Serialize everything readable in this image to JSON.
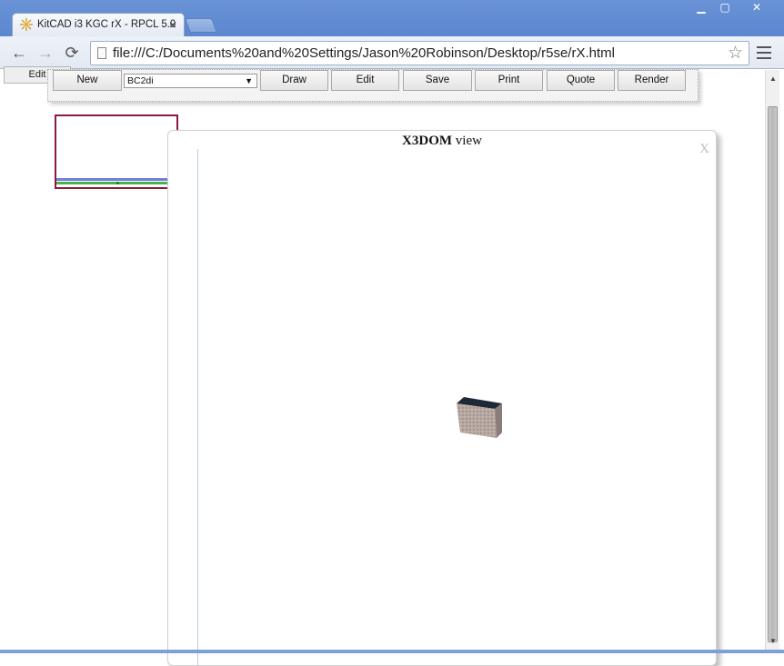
{
  "browser": {
    "tab_title": "KitCAD i3 KGC rX - RPCL 5.0",
    "tab_close": "×",
    "url": "file:///C:/Documents%20and%20Settings/Jason%20Robinson/Desktop/r5se/rX.html",
    "window_controls": {
      "minimize": "▁",
      "maximize": "▢",
      "close": "✕"
    },
    "nav_icons": {
      "back": "←",
      "forward": "→",
      "reload": "⟳",
      "star": "☆"
    }
  },
  "page": {
    "edit_tab": "Edit",
    "toolbar": {
      "new": "New",
      "select_value": "BC2di",
      "draw": "Draw",
      "edit": "Edit",
      "save": "Save",
      "print": "Print",
      "quote": "Quote",
      "render": "Render"
    },
    "dialog": {
      "title_bold": "X3DOM",
      "title_rest": " view",
      "close": "X"
    }
  },
  "colors": {
    "titlebar": "#5c87cf",
    "thumbnail_border": "#8c1a3a",
    "blue_line": "#6f7fd6",
    "green_line": "#4caf50"
  }
}
